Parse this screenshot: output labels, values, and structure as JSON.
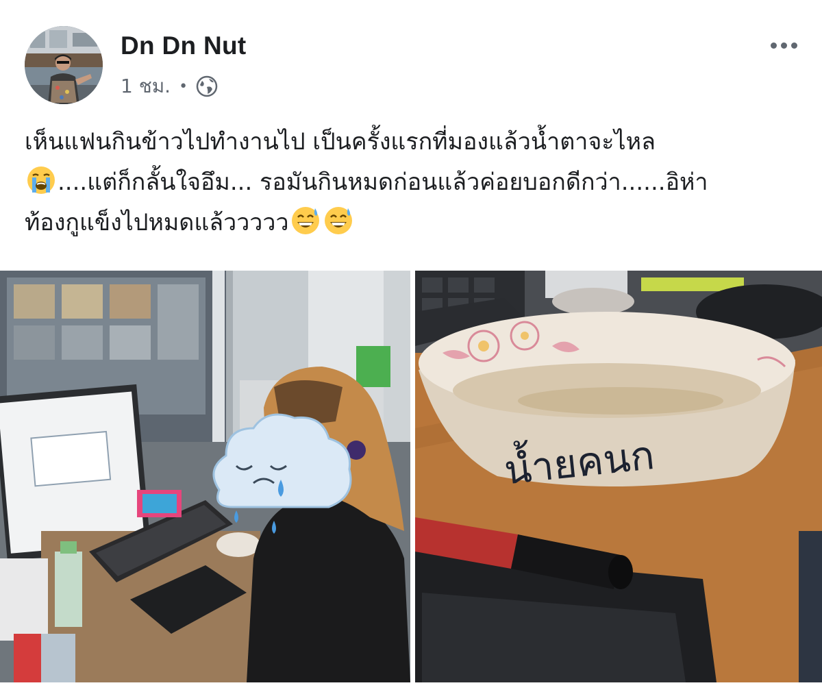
{
  "post": {
    "author": "Dn Dn Nut",
    "time": "1 ชม.",
    "separator": "•",
    "privacy_icon": "globe-icon",
    "more_icon": "more-horizontal-icon",
    "text_lines": [
      "เห็นแฟนกินข้าวไปทำงานไป เป็นครั้งแรกที่มองแล้วน้ำตาจะไหล",
      "....แต่ก็กลั้นใจอึม... รอมันกินหมดก่อนแล้วค่อยบอกดีกว่า......อิห่า",
      "ท้องกูแข็งไปหมดแล้ววววว"
    ],
    "emojis": {
      "line2_start": "loudly-crying-face-emoji",
      "line3_end": [
        "grinning-sweat-emoji",
        "grinning-sweat-emoji"
      ]
    },
    "photos": [
      {
        "name": "woman-at-computer-photo"
      },
      {
        "name": "bowl-on-desk-photo",
        "bowl_text": "น้ำยคนก"
      }
    ]
  },
  "colors": {
    "text": "#1c1e21",
    "meta": "#606770",
    "background": "#ffffff"
  }
}
